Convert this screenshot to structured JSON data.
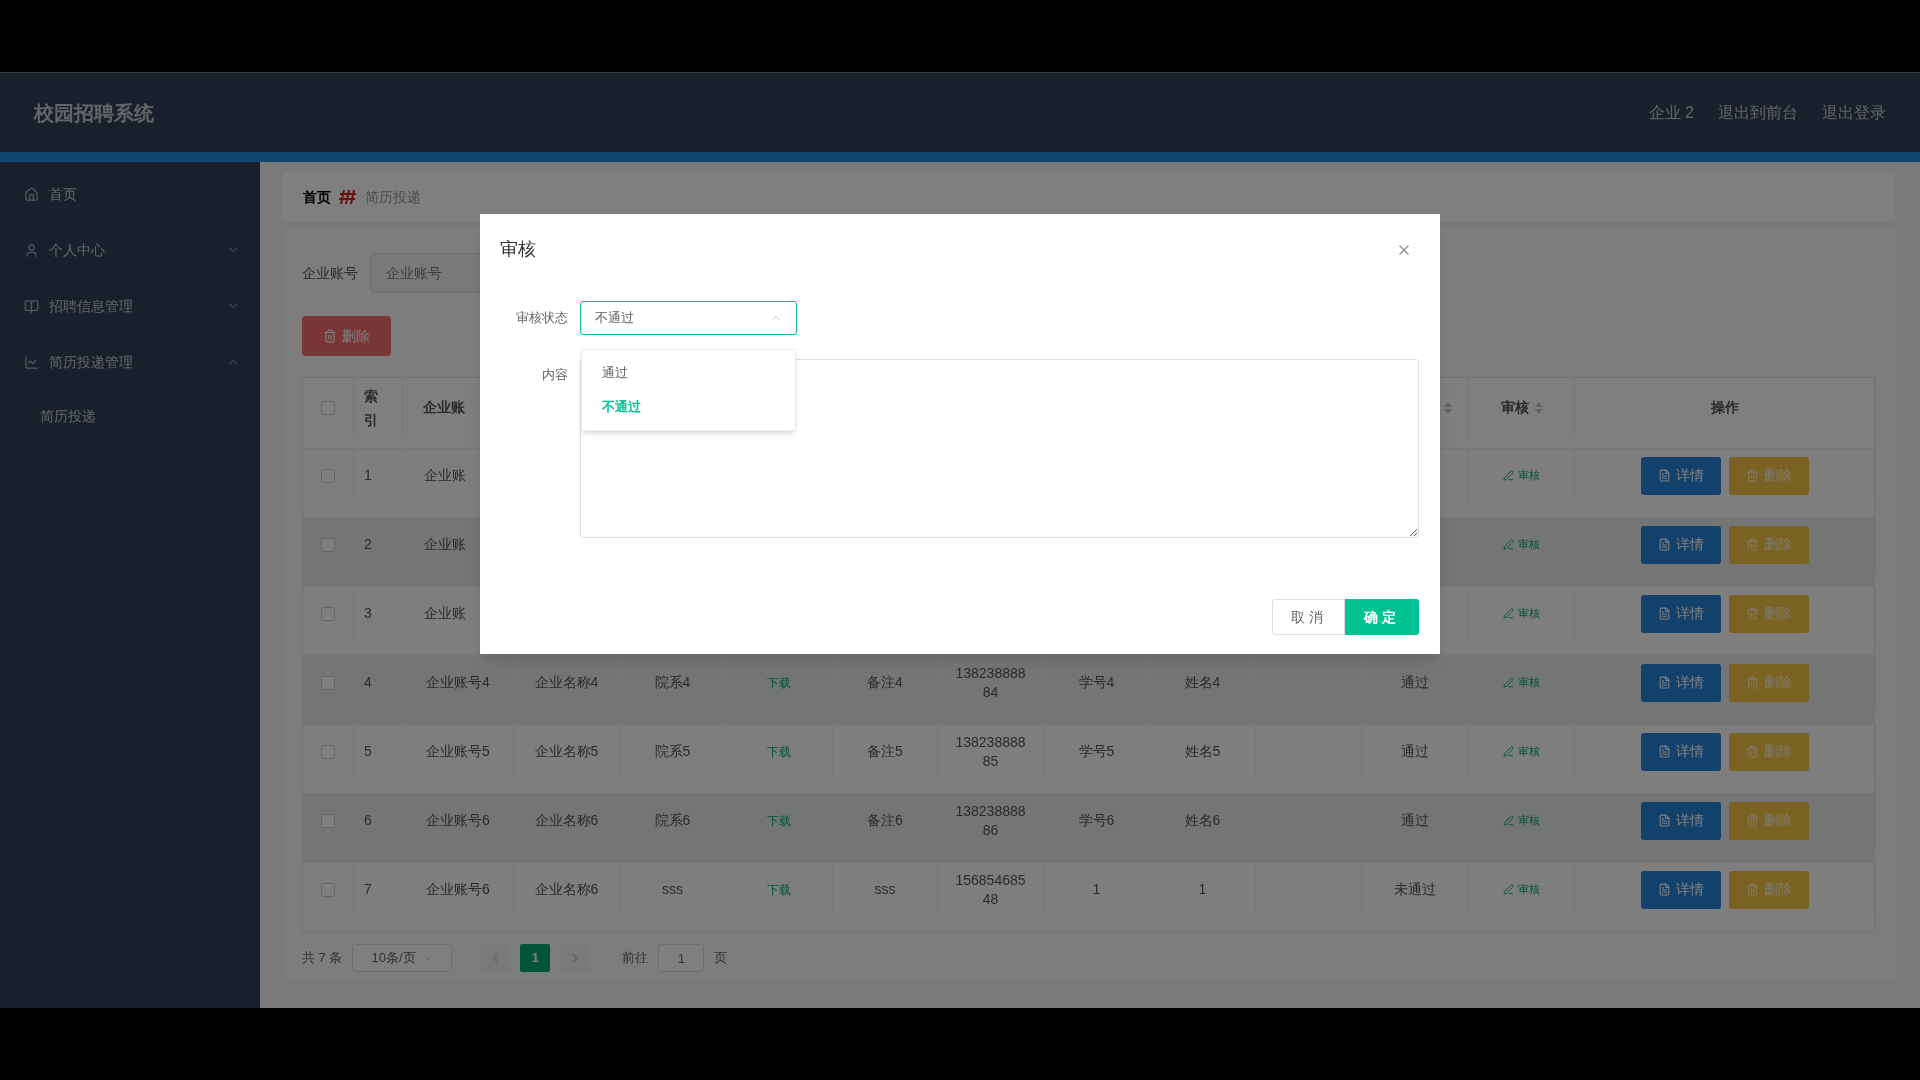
{
  "header": {
    "title": "校园招聘系统",
    "links": [
      "企业 2",
      "退出到前台",
      "退出登录"
    ]
  },
  "sidebar": {
    "items": [
      {
        "kind": "link",
        "label": "首页"
      },
      {
        "kind": "group",
        "label": "个人中心",
        "expanded": false
      },
      {
        "kind": "group",
        "label": "招聘信息管理",
        "expanded": false
      },
      {
        "kind": "group",
        "label": "简历投递管理",
        "expanded": true,
        "children": [
          {
            "label": "简历投递"
          }
        ]
      }
    ]
  },
  "breadcrumb": [
    "首页",
    "简历投递"
  ],
  "search": {
    "label": "企业账号",
    "placeholder": "企业账号"
  },
  "delete_button": "删除",
  "table": {
    "all_checked": false,
    "columns": [
      {
        "label": "索引",
        "sortable": false
      },
      {
        "label": "企业账"
      },
      {},
      {},
      {},
      {},
      {},
      {},
      {},
      {},
      {
        "sortable": true
      },
      {
        "label": "审核",
        "sortable": true
      },
      {
        "label": "操作",
        "sortable": false
      }
    ],
    "rows": [
      {
        "checked": false,
        "index": "1",
        "account": "企业账",
        "audit": "审核",
        "actions": [
          "详情",
          "删除"
        ]
      },
      {
        "checked": false,
        "index": "2",
        "account": "企业账",
        "audit": "审核",
        "actions": [
          "详情",
          "删除"
        ]
      },
      {
        "checked": false,
        "index": "3",
        "account": "企业账",
        "audit": "审核",
        "actions": [
          "详情",
          "删除"
        ]
      },
      {
        "checked": false,
        "index": "4",
        "account": "企业账号4",
        "company": "企业名称4",
        "department": "院系4",
        "resume": "下载",
        "note": "备注4",
        "phone": "13823888884",
        "student_no": "学号4",
        "name": "姓名4",
        "status": "通过",
        "audit": "审核",
        "actions": [
          "详情",
          "删除"
        ]
      },
      {
        "checked": false,
        "index": "5",
        "account": "企业账号5",
        "company": "企业名称5",
        "department": "院系5",
        "resume": "下载",
        "note": "备注5",
        "phone": "13823888885",
        "student_no": "学号5",
        "name": "姓名5",
        "status": "通过",
        "audit": "审核",
        "actions": [
          "详情",
          "删除"
        ]
      },
      {
        "checked": false,
        "index": "6",
        "account": "企业账号6",
        "company": "企业名称6",
        "department": "院系6",
        "resume": "下载",
        "note": "备注6",
        "phone": "13823888886",
        "student_no": "学号6",
        "name": "姓名6",
        "status": "通过",
        "audit": "审核",
        "actions": [
          "详情",
          "删除"
        ]
      },
      {
        "checked": false,
        "index": "7",
        "account": "企业账号6",
        "company": "企业名称6",
        "department": "sss",
        "resume": "下载",
        "note": "sss",
        "phone": "15685468548",
        "student_no": "1",
        "name": "1",
        "status": "未通过",
        "audit": "审核",
        "actions": [
          "详情",
          "删除"
        ]
      }
    ]
  },
  "pagination": {
    "total": "共 7 条",
    "page_size": "10条/页",
    "pages": [
      {
        "label": "1",
        "selected": true
      }
    ],
    "goto_label": "前往",
    "goto_value": "1",
    "goto_suffix": "页"
  },
  "dialog": {
    "title": "审核",
    "status_label": "审核状态",
    "status_value": "不通过",
    "expanded": true,
    "options": [
      {
        "label": "通过",
        "selected": false
      },
      {
        "label": "不通过",
        "selected": true
      }
    ],
    "content_label": "内容",
    "buttons": [
      "取消",
      "确定"
    ]
  }
}
